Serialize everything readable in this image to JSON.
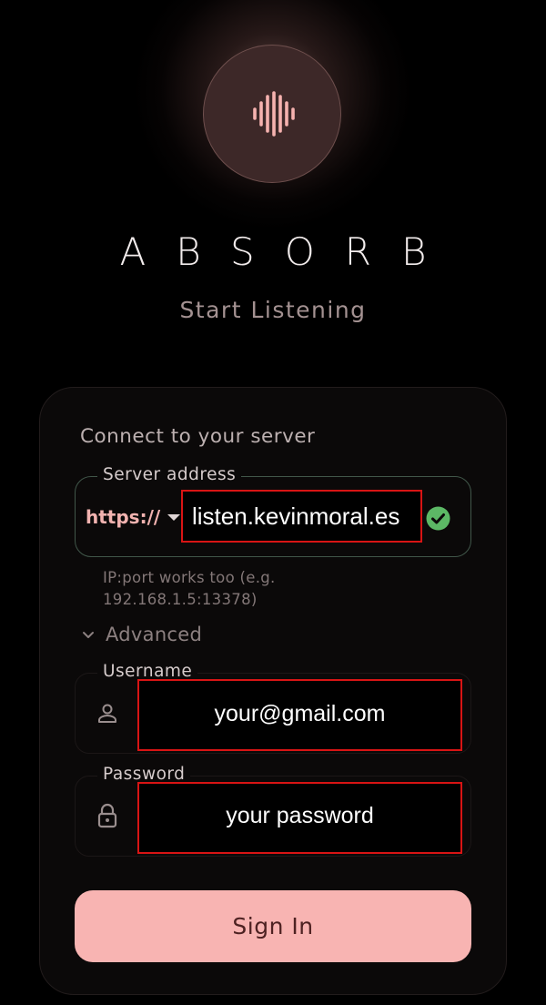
{
  "app": {
    "title": "ABSORB",
    "subtitle": "Start Listening",
    "logo_icon": "sound-wave-icon"
  },
  "form": {
    "heading": "Connect to your server",
    "server": {
      "label": "Server address",
      "protocol": "https://",
      "value": "listen.kevinmoral.es",
      "helper": "IP:port works too (e.g. 192.168.1.5:13378)",
      "status_icon": "check-circle-icon"
    },
    "advanced": {
      "label": "Advanced",
      "icon": "chevron-down-icon"
    },
    "username": {
      "label": "Username",
      "value": "your@gmail.com",
      "icon": "person-icon"
    },
    "password": {
      "label": "Password",
      "value": "your password",
      "icon": "lock-icon"
    },
    "submit_label": "Sign In"
  },
  "colors": {
    "background": "#000000",
    "card": "#0b0909",
    "accent": "#f8b4b2",
    "accent_text": "#4e2222",
    "protocol": "#f2b3b0",
    "success": "#5cb865",
    "redaction_border": "#d81414"
  }
}
